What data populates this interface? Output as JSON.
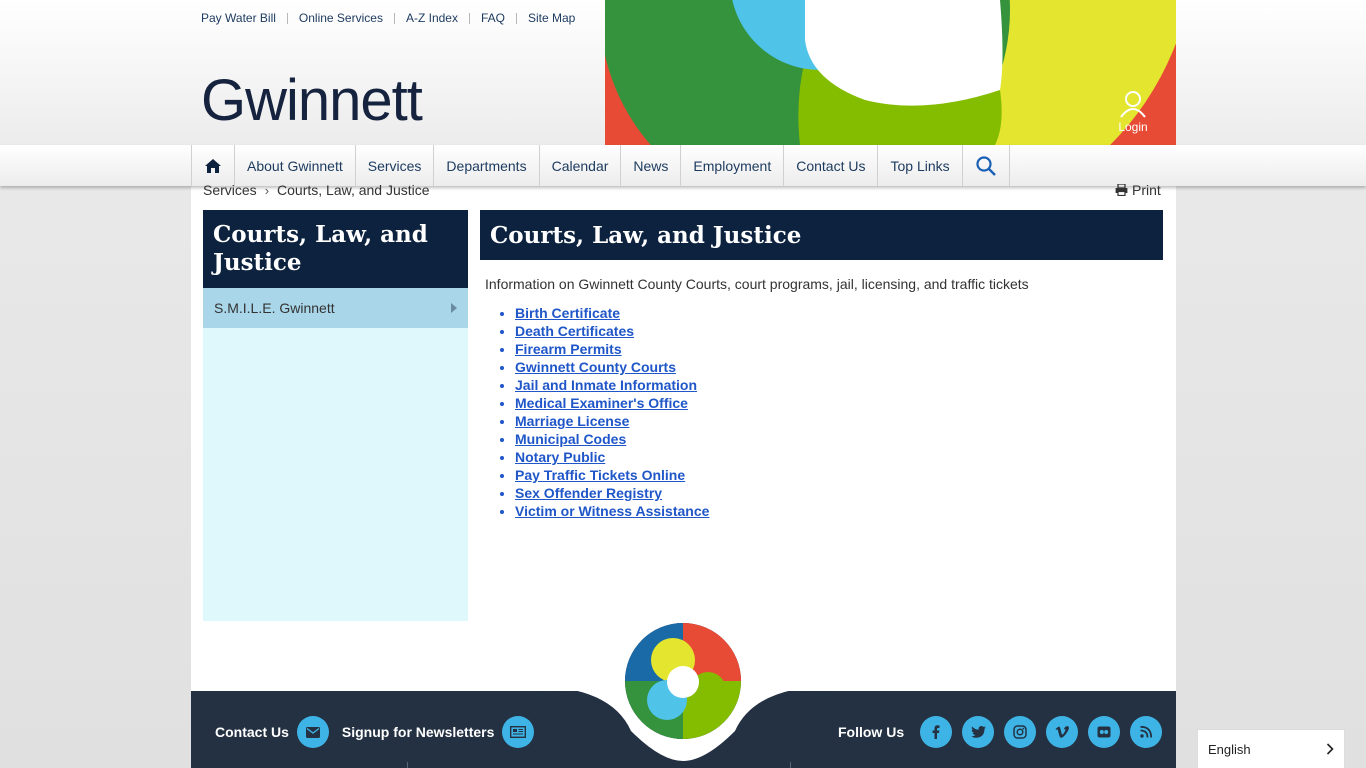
{
  "utility_links": [
    "Pay Water Bill",
    "Online Services",
    "A-Z Index",
    "FAQ",
    "Site Map"
  ],
  "logo_text": "Gwinnett",
  "login_label": "Login",
  "nav": {
    "home_icon": "home-icon",
    "items": [
      "About Gwinnett",
      "Services",
      "Departments",
      "Calendar",
      "News",
      "Employment",
      "Contact Us",
      "Top Links"
    ],
    "search_icon": "search-icon"
  },
  "breadcrumb": {
    "parent": "Services",
    "current": "Courts, Law, and Justice"
  },
  "print_label": "Print",
  "sidebar": {
    "title": "Courts, Law, and Justice",
    "items": [
      {
        "label": "S.M.I.L.E. Gwinnett"
      }
    ]
  },
  "main": {
    "title": "Courts, Law, and Justice",
    "description": "Information on Gwinnett County Courts, court programs, jail, licensing, and traffic tickets",
    "links": [
      "Birth Certificate",
      "Death Certificates",
      "Firearm Permits",
      "Gwinnett County Courts",
      "Jail and Inmate Information",
      "Medical Examiner's Office",
      "Marriage License",
      "Municipal Codes",
      "Notary Public",
      "Pay Traffic Tickets Online",
      "Sex Offender Registry",
      "Victim or Witness Assistance"
    ]
  },
  "footer": {
    "contact_label": "Contact Us",
    "newsletter_label": "Signup for Newsletters",
    "follow_label": "Follow Us",
    "social": [
      "facebook-icon",
      "twitter-icon",
      "instagram-icon",
      "vimeo-icon",
      "flickr-icon",
      "rss-icon"
    ]
  },
  "language": {
    "selected": "English"
  },
  "colors": {
    "navy": "#0c223e",
    "link": "#1f56c8",
    "sidebar_bg": "#dff8fc",
    "sidebar_item": "#a9d6e8",
    "footer_bg": "#243142",
    "accent_blue": "#3eb4e6"
  }
}
